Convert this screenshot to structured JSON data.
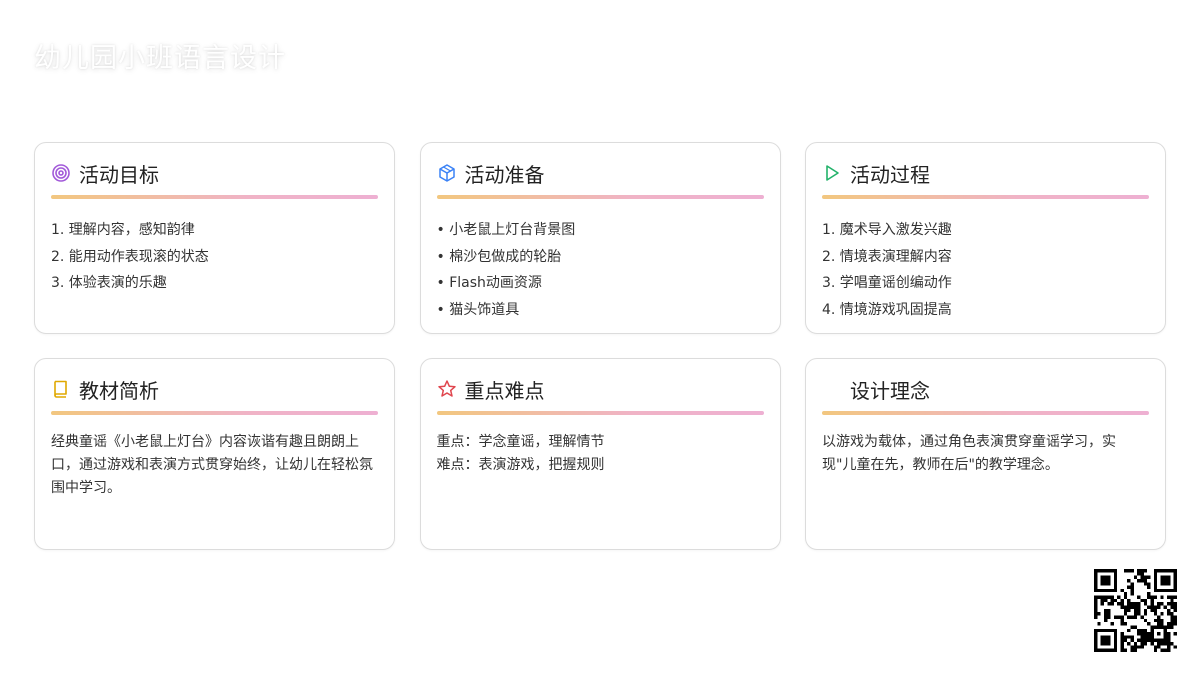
{
  "page": {
    "title": "幼儿园小班语言设计"
  },
  "cards": [
    {
      "title": "活动目标",
      "icon": "target-icon",
      "lines": [
        "1. 理解内容，感知韵律",
        "2. 能用动作表现滚的状态",
        "3. 体验表演的乐趣"
      ]
    },
    {
      "title": "活动准备",
      "icon": "box-icon",
      "lines": [
        "• 小老鼠上灯台背景图",
        "• 棉沙包做成的轮胎",
        "• Flash动画资源",
        "• 猫头饰道具"
      ]
    },
    {
      "title": "活动过程",
      "icon": "play-icon",
      "lines": [
        "1. 魔术导入激发兴趣",
        "2. 情境表演理解内容",
        "3. 学唱童谣创编动作",
        "4. 情境游戏巩固提高"
      ]
    },
    {
      "title": "教材简析",
      "icon": "book-icon",
      "lines": [
        "经典童谣《小老鼠上灯台》内容诙谐有趣且朗朗上",
        "口，通过游戏和表演方式贯穿始终，让幼儿在轻松氛",
        "围中学习。"
      ]
    },
    {
      "title": "重点难点",
      "icon": "star-icon",
      "lines": [
        "重点：学念童谣，理解情节",
        "难点：表演游戏，把握规则"
      ]
    },
    {
      "title": "设计理念",
      "icon": "",
      "lines": [
        "以游戏为载体，通过角色表演贯穿童谣学习，实",
        "现\"儿童在先，教师在后\"的教学理念。"
      ]
    }
  ],
  "colors": {
    "target": "#a259d9",
    "box": "#3b82f6",
    "play": "#22b26a",
    "book": "#e0a800",
    "star": "#e0464e",
    "divider_start": "#f2c77f",
    "divider_end": "#eeb0d2"
  },
  "qr_code": "qr-code-icon"
}
